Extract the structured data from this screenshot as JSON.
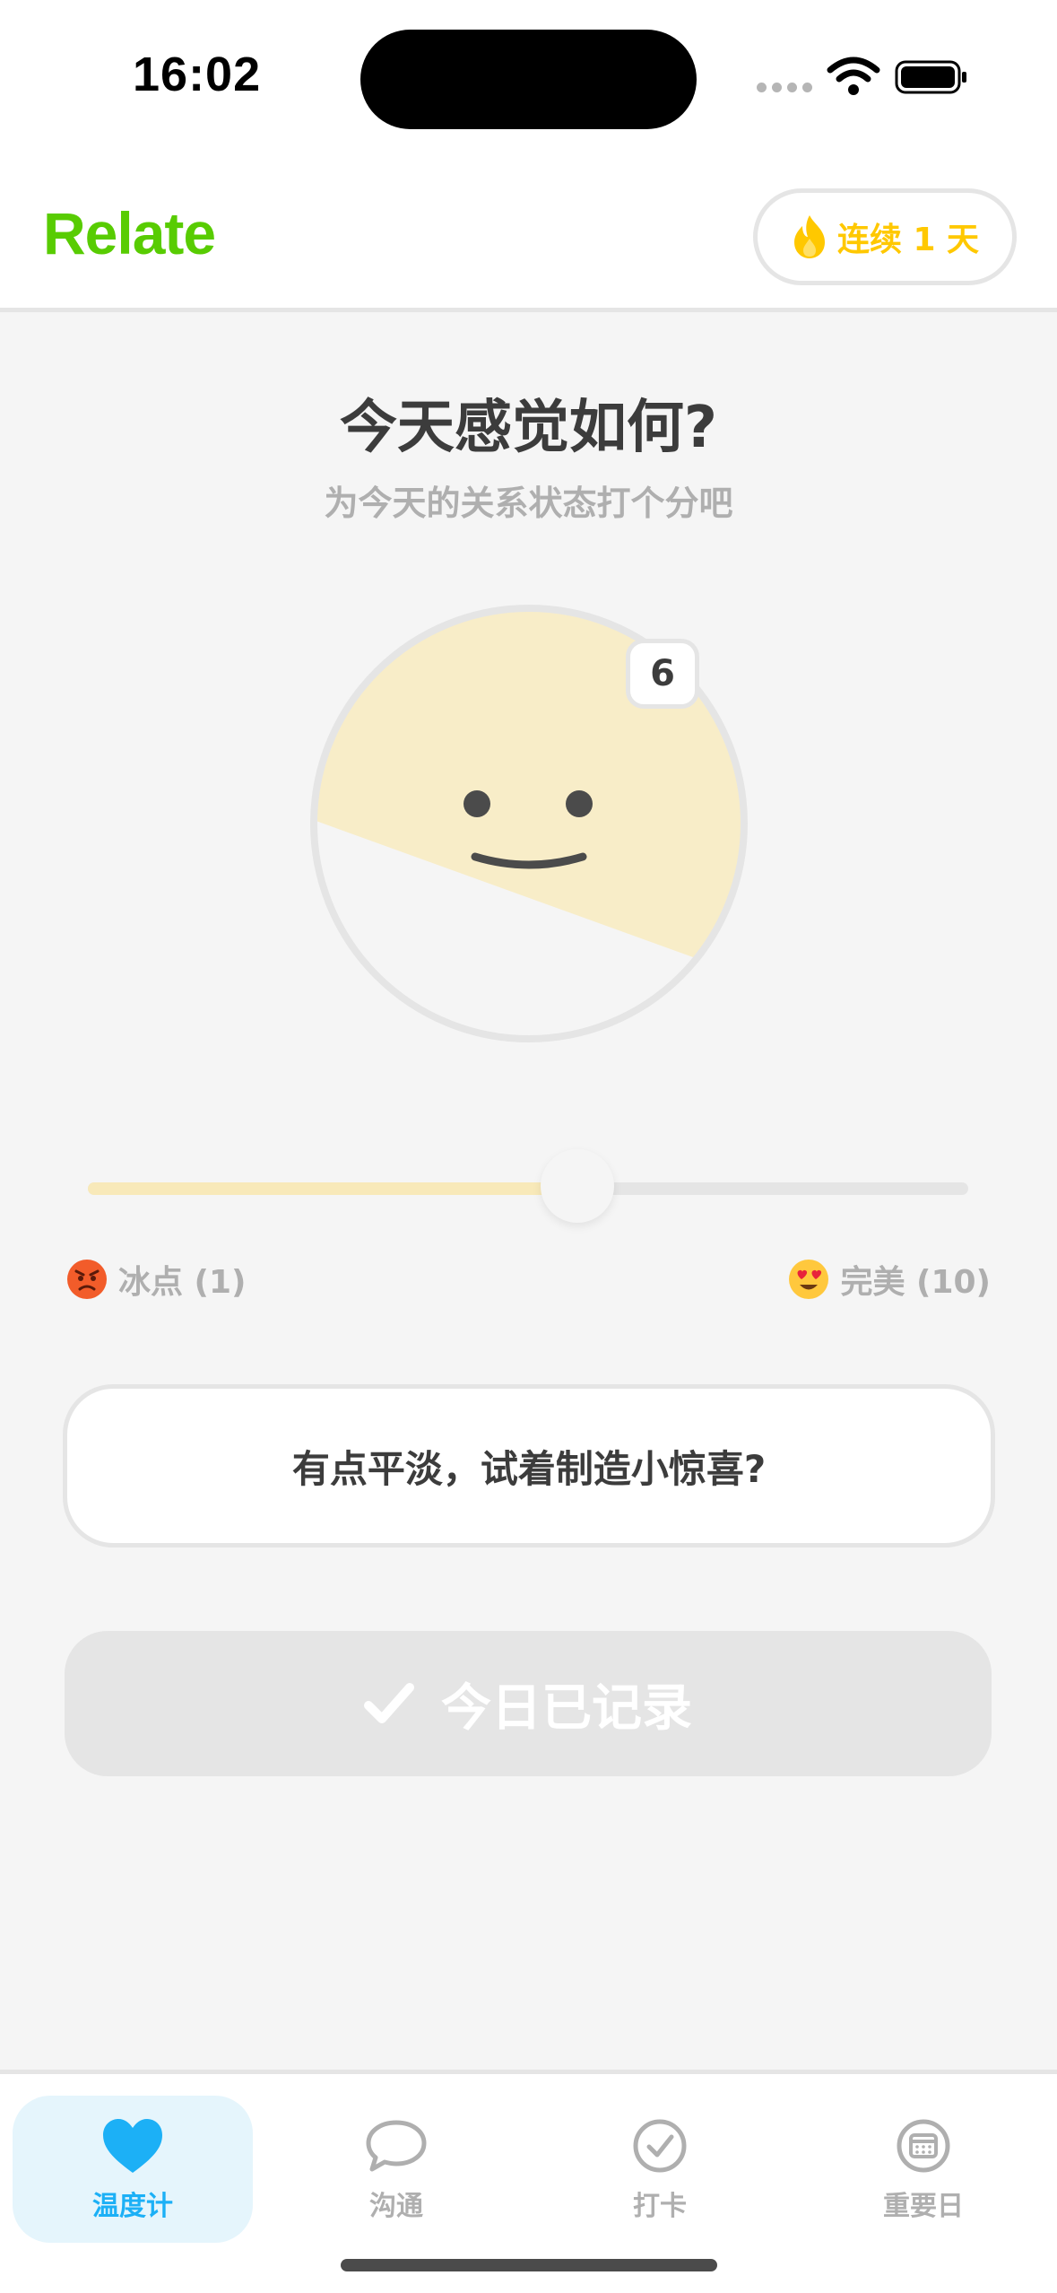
{
  "status_bar": {
    "time": "16:02"
  },
  "header": {
    "app_name": "Relate",
    "streak_label": "连续 1 天",
    "brand_color": "#58cc02",
    "streak_color": "#ffc800"
  },
  "main": {
    "title": "今天感觉如何?",
    "subtitle": "为今天的关系状态打个分吧",
    "score": "6",
    "face_fill_color": "#f8edc8",
    "slider": {
      "min": 1,
      "max": 10,
      "value": 6
    },
    "min_label": "冰点 (1)",
    "max_label": "完美 (10)",
    "hint": "有点平淡，试着制造小惊喜?",
    "recorded_button": "今日已记录"
  },
  "tab_bar": {
    "tabs": [
      {
        "label": "温度计",
        "icon": "heart-icon",
        "active": true
      },
      {
        "label": "沟通",
        "icon": "chat-bubble-icon",
        "active": false
      },
      {
        "label": "打卡",
        "icon": "check-circle-icon",
        "active": false
      },
      {
        "label": "重要日",
        "icon": "calendar-icon",
        "active": false
      }
    ],
    "active_color": "#1cb0f6"
  }
}
